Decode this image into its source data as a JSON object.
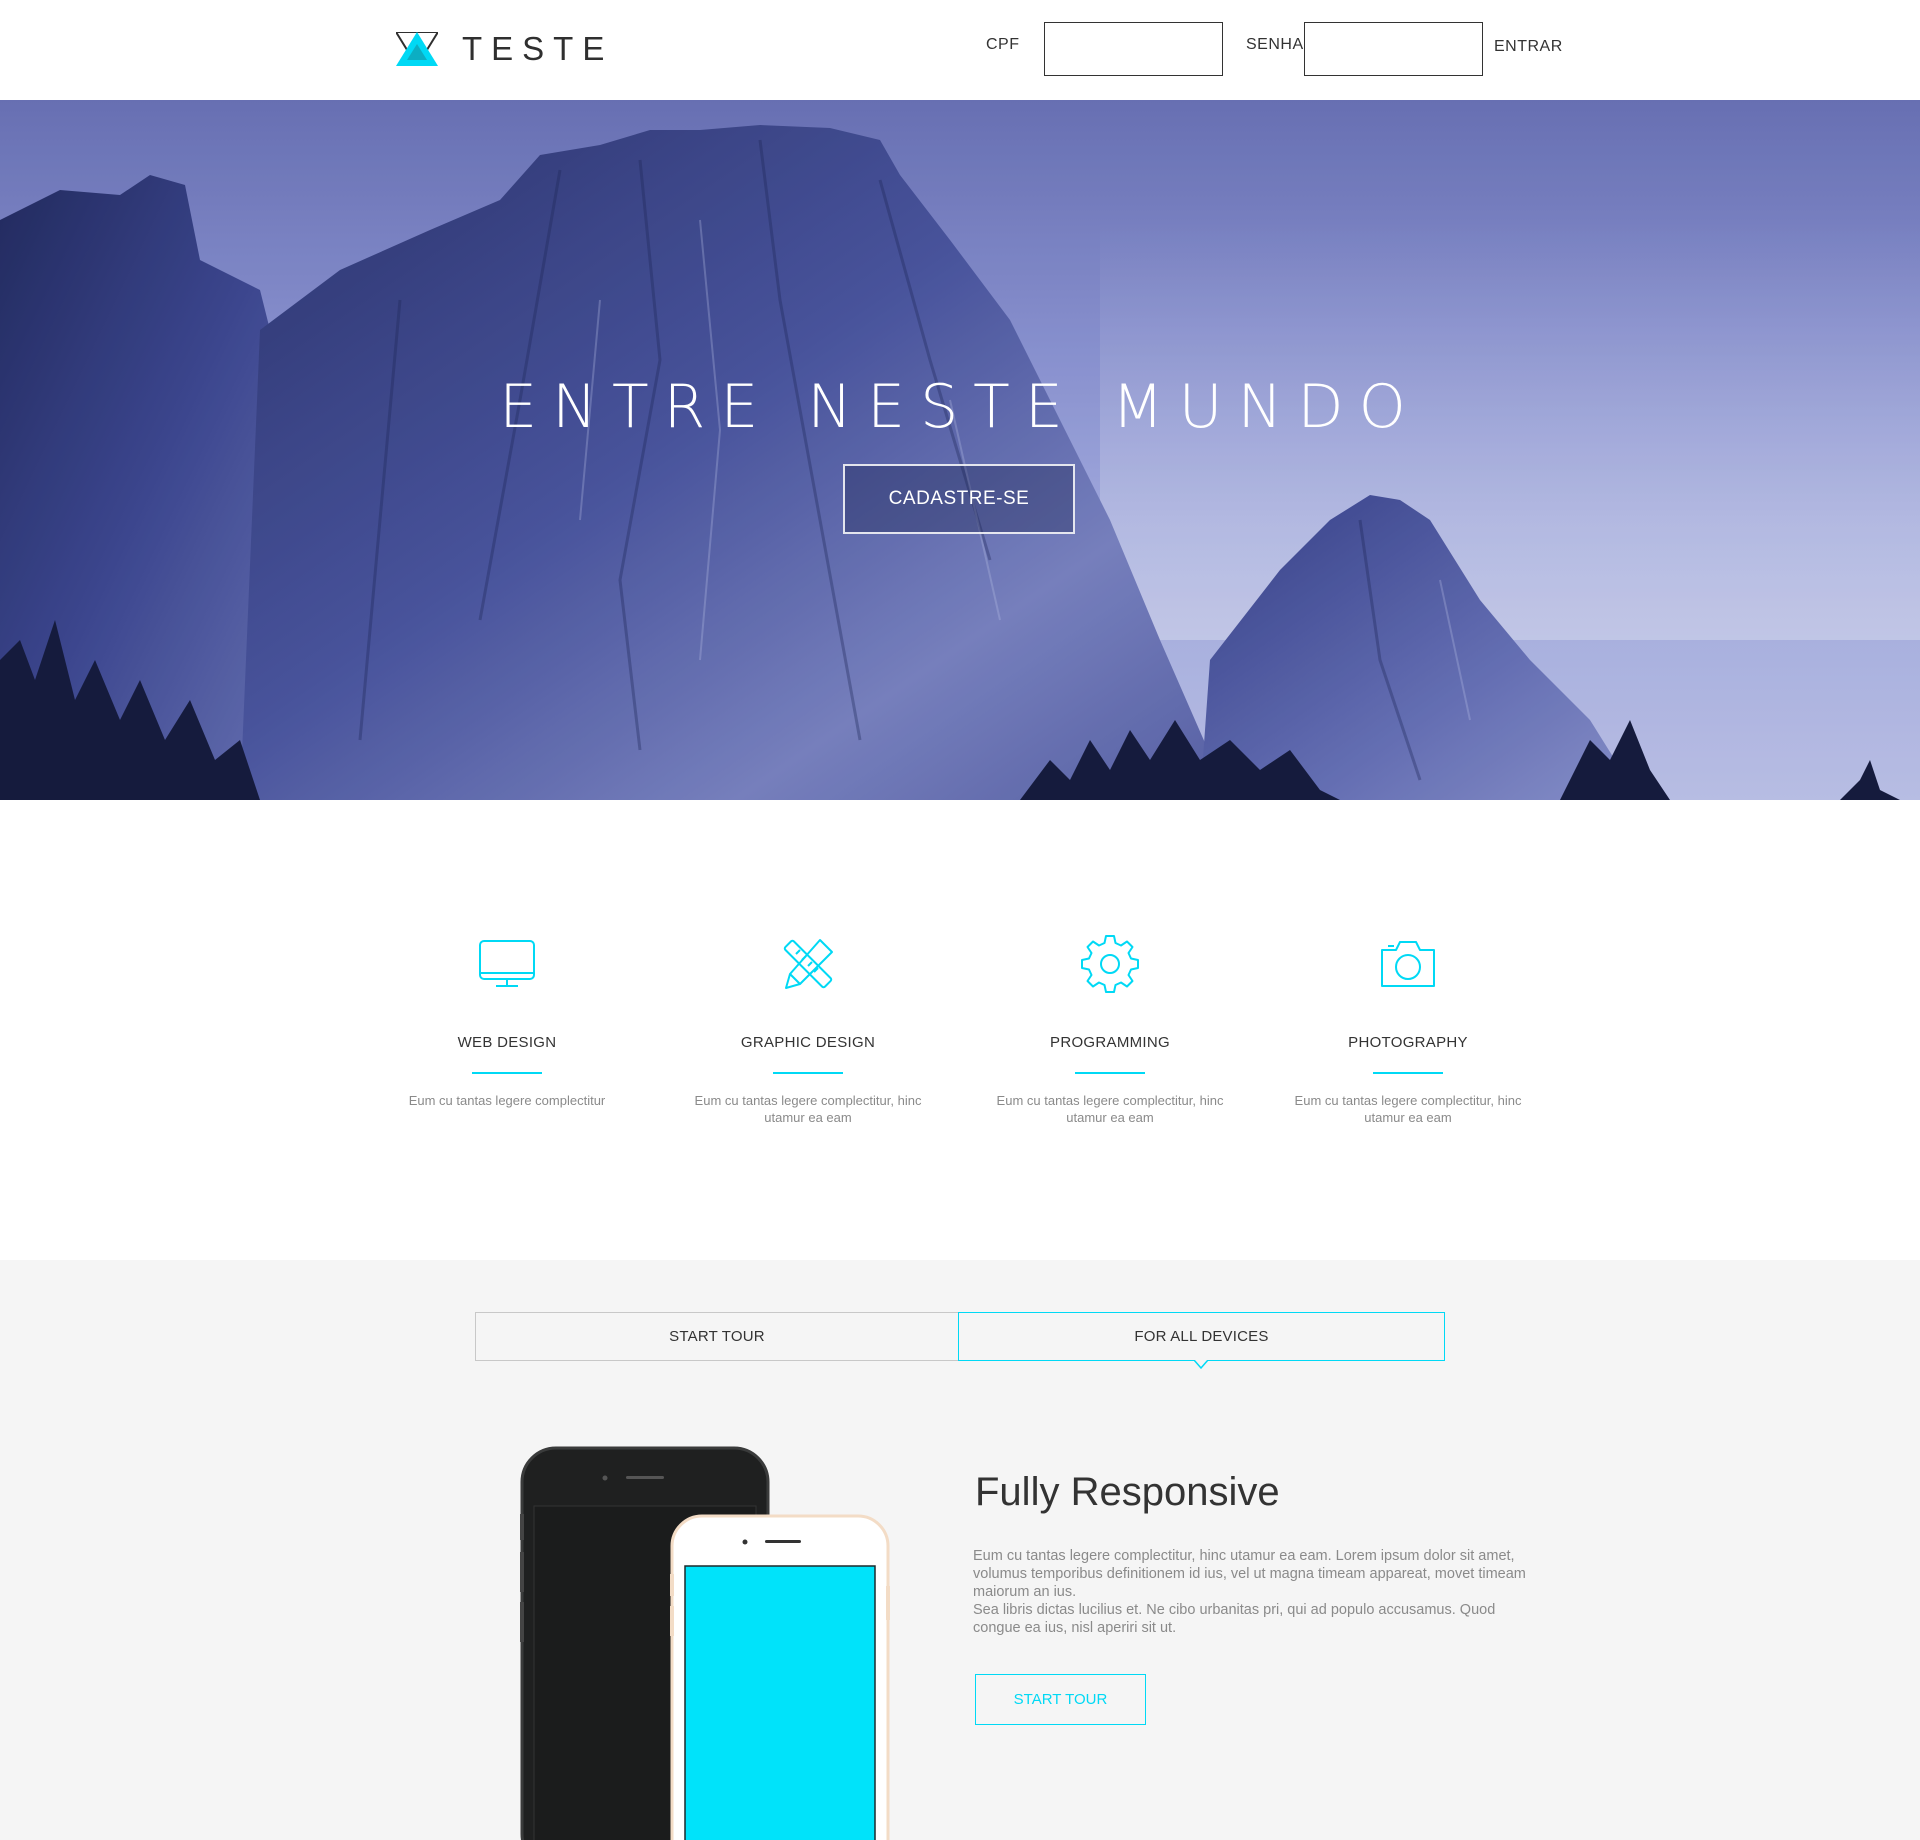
{
  "header": {
    "brand": "TESTE",
    "cpf_label": "CPF",
    "senha_label": "SENHA",
    "cpf_value": "",
    "senha_value": "",
    "login_button": "ENTRAR"
  },
  "hero": {
    "title": "ENTRE NESTE MUNDO",
    "cta": "CADASTRE-SE"
  },
  "services": [
    {
      "icon": "monitor-icon",
      "title": "WEB DESIGN",
      "desc": "Eum cu tantas legere complectitur"
    },
    {
      "icon": "pencil-ruler-icon",
      "title": "GRAPHIC DESIGN",
      "desc": "Eum cu tantas legere complectitur, hinc utamur ea eam"
    },
    {
      "icon": "gear-icon",
      "title": "PROGRAMMING",
      "desc": "Eum cu tantas legere complectitur, hinc utamur ea eam"
    },
    {
      "icon": "camera-icon",
      "title": "PHOTOGRAPHY",
      "desc": "Eum cu tantas legere complectitur, hinc utamur ea eam"
    }
  ],
  "tour": {
    "tabs": [
      {
        "label": "START TOUR",
        "active": false
      },
      {
        "label": "FOR ALL DEVICES",
        "active": true
      }
    ],
    "feature_title": "Fully Responsive",
    "feature_paragraphs": [
      "Eum cu tantas legere complectitur, hinc utamur ea eam. Lorem ipsum dolor sit amet, volumus temporibus definitionem id ius, vel ut magna timeam appareat, movet timeam maiorum an ius.",
      "Sea libris dictas lucilius et. Ne cibo urbanitas pri, qui ad populo accusamus. Quod congue ea ius, nisl aperiri sit ut."
    ],
    "cta": "START TOUR"
  },
  "colors": {
    "accent": "#00d9f5",
    "text": "#333333",
    "muted": "#8a8a8a",
    "section_bg": "#f5f5f5"
  }
}
